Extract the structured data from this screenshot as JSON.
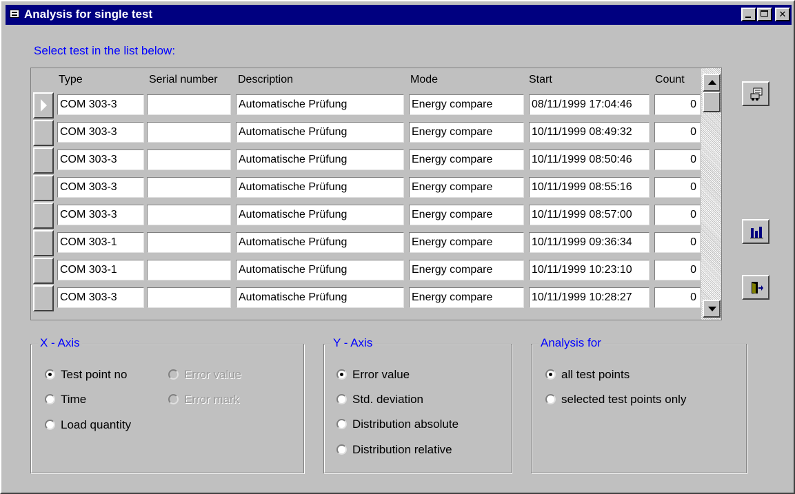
{
  "window": {
    "title": "Analysis for single test",
    "controls": {
      "minimize": "_",
      "maximize": "□",
      "close": "✕"
    }
  },
  "prompt": "Select test in the list below:",
  "table": {
    "columns": [
      "Type",
      "Serial number",
      "Description",
      "Mode",
      "Start",
      "Count"
    ],
    "selected_row": 0,
    "rows": [
      {
        "type": "COM 303-3",
        "serial": "",
        "description": "Automatische Prüfung",
        "mode": "Energy compare",
        "start": "08/11/1999 17:04:46",
        "count": "0"
      },
      {
        "type": "COM 303-3",
        "serial": "",
        "description": "Automatische Prüfung",
        "mode": "Energy compare",
        "start": "10/11/1999 08:49:32",
        "count": "0"
      },
      {
        "type": "COM 303-3",
        "serial": "",
        "description": "Automatische Prüfung",
        "mode": "Energy compare",
        "start": "10/11/1999 08:50:46",
        "count": "0"
      },
      {
        "type": "COM 303-3",
        "serial": "",
        "description": "Automatische Prüfung",
        "mode": "Energy compare",
        "start": "10/11/1999 08:55:16",
        "count": "0"
      },
      {
        "type": "COM 303-3",
        "serial": "",
        "description": "Automatische Prüfung",
        "mode": "Energy compare",
        "start": "10/11/1999 08:57:00",
        "count": "0"
      },
      {
        "type": "COM 303-1",
        "serial": "",
        "description": "Automatische Prüfung",
        "mode": "Energy compare",
        "start": "10/11/1999 09:36:34",
        "count": "0"
      },
      {
        "type": "COM 303-1",
        "serial": "",
        "description": "Automatische Prüfung",
        "mode": "Energy compare",
        "start": "10/11/1999 10:23:10",
        "count": "0"
      },
      {
        "type": "COM 303-3",
        "serial": "",
        "description": "Automatische Prüfung",
        "mode": "Energy compare",
        "start": "10/11/1999 10:28:27",
        "count": "0"
      }
    ]
  },
  "side_buttons": [
    {
      "icon": "report-preview-icon"
    },
    {
      "icon": "bar-chart-icon"
    },
    {
      "icon": "exit-door-icon"
    }
  ],
  "x_axis": {
    "title": "X - Axis",
    "options": [
      {
        "label": "Test point no",
        "checked": true,
        "enabled": true
      },
      {
        "label": "Time",
        "checked": false,
        "enabled": true
      },
      {
        "label": "Load quantity",
        "checked": false,
        "enabled": true
      },
      {
        "label": "Error value",
        "checked": false,
        "enabled": false
      },
      {
        "label": "Error mark",
        "checked": false,
        "enabled": false
      }
    ]
  },
  "y_axis": {
    "title": "Y - Axis",
    "options": [
      {
        "label": "Error value",
        "checked": true,
        "enabled": true
      },
      {
        "label": "Std. deviation",
        "checked": false,
        "enabled": true
      },
      {
        "label": "Distribution absolute",
        "checked": false,
        "enabled": true
      },
      {
        "label": "Distribution relative",
        "checked": false,
        "enabled": true
      }
    ]
  },
  "analysis_for": {
    "title": "Analysis for",
    "options": [
      {
        "label": "all test points",
        "checked": true,
        "enabled": true
      },
      {
        "label": "selected test points only",
        "checked": false,
        "enabled": true
      }
    ]
  },
  "colors": {
    "title_bar": "#000080",
    "accent_text": "#0000ff",
    "face": "#c0c0c0"
  }
}
